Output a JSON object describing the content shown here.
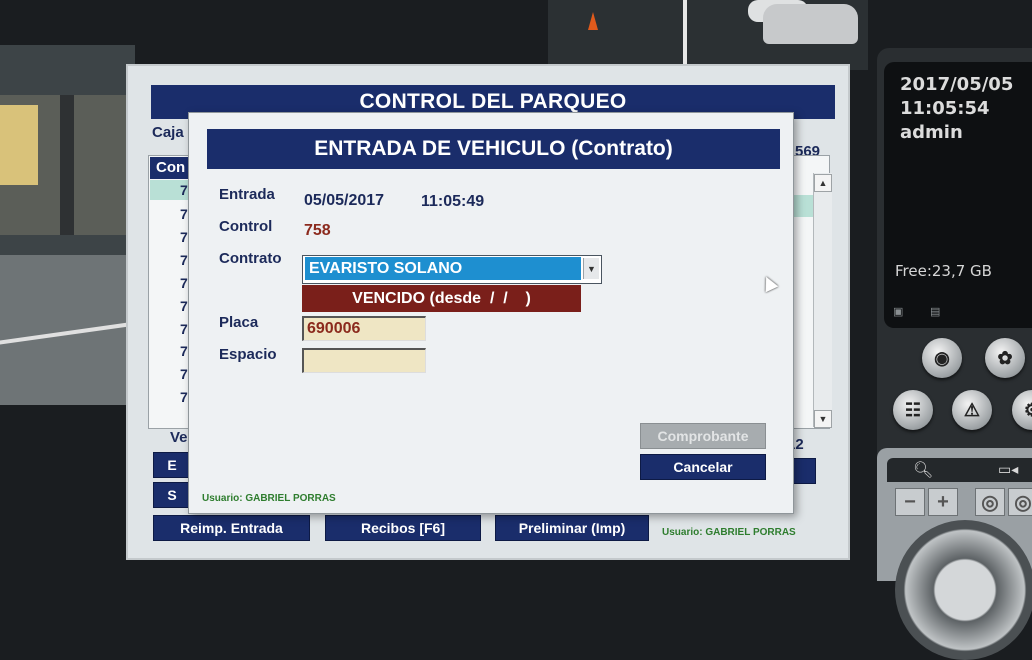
{
  "dvr": {
    "date": "2017/05/05",
    "time": "11:05:54",
    "user": "admin",
    "free_space": "Free:23,7 GB"
  },
  "main_window": {
    "title": "CONTROL DEL PARQUEO",
    "caja_label": "Caja",
    "list_header": "Con",
    "list_rows": [
      "7",
      "7",
      "7",
      "7",
      "7",
      "7",
      "7",
      "7",
      "7",
      "7",
      "7"
    ],
    "right_number": "569",
    "bottom_left_label": "Ve",
    "bottom_right_number": "12",
    "left_buttons": [
      "E",
      "S"
    ],
    "buttons": {
      "reprint": "Reimp. Entrada",
      "receipts": "Recibos  [F6]",
      "preliminary": "Preliminar (Imp)"
    },
    "user_label": "Usuario:  GABRIEL PORRAS"
  },
  "dialog": {
    "title": "ENTRADA DE VEHICULO (Contrato)",
    "labels": {
      "entrada": "Entrada",
      "control": "Control",
      "contrato": "Contrato",
      "placa": "Placa",
      "espacio": "Espacio"
    },
    "entrada_date": "05/05/2017",
    "entrada_time": "11:05:49",
    "control_value": "758",
    "contrato_value": "EVARISTO SOLANO",
    "status": "VENCIDO (desde  /  /    )",
    "placa_value": "690006",
    "espacio_value": "",
    "buttons": {
      "comprobante": "Comprobante",
      "cancelar": "Cancelar"
    },
    "user_label": "Usuario:  GABRIEL PORRAS"
  },
  "colors": {
    "navy": "#1a2d6b",
    "selection_blue": "#1e8fd0",
    "status_red": "#7a1f1a",
    "field_bg": "#efe6c4",
    "user_green": "#2e7d2e"
  }
}
